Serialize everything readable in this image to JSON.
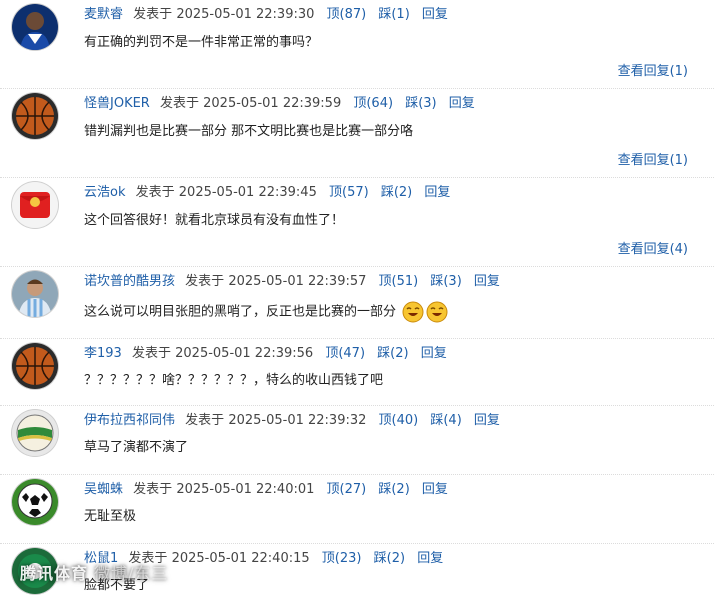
{
  "comments": [
    {
      "user": "麦默睿",
      "posted": "发表于",
      "time": "2025-05-01 22:39:30",
      "up": "顶(87)",
      "down": "踩(1)",
      "reply": "回复",
      "text": "有正确的判罚不是一件非常正常的事吗？",
      "view_replies": "查看回复(1)"
    },
    {
      "user": "怪兽JOKER",
      "posted": "发表于",
      "time": "2025-05-01 22:39:59",
      "up": "顶(64)",
      "down": "踩(3)",
      "reply": "回复",
      "text": "错判漏判也是比赛一部分 那不文明比赛也是比赛一部分咯",
      "view_replies": "查看回复(1)"
    },
    {
      "user": "云浩ok",
      "posted": "发表于",
      "time": "2025-05-01 22:39:45",
      "up": "顶(57)",
      "down": "踩(2)",
      "reply": "回复",
      "text": "这个回答很好！就看北京球员有没有血性了！",
      "view_replies": "查看回复(4)"
    },
    {
      "user": "诺坎普的酷男孩",
      "posted": "发表于",
      "time": "2025-05-01 22:39:57",
      "up": "顶(51)",
      "down": "踩(3)",
      "reply": "回复",
      "text": "这么说可以明目张胆的黑哨了，反正也是比赛的一部分",
      "view_replies": ""
    },
    {
      "user": "李193",
      "posted": "发表于",
      "time": "2025-05-01 22:39:56",
      "up": "顶(47)",
      "down": "踩(2)",
      "reply": "回复",
      "text": "？？？？？？啥？？？？？？，特么的收山西钱了吧",
      "view_replies": ""
    },
    {
      "user": "伊布拉西祁同伟",
      "posted": "发表于",
      "time": "2025-05-01 22:39:32",
      "up": "顶(40)",
      "down": "踩(4)",
      "reply": "回复",
      "text": "草马了演都不演了",
      "view_replies": ""
    },
    {
      "user": "吴蜘蛛",
      "posted": "发表于",
      "time": "2025-05-01 22:40:01",
      "up": "顶(27)",
      "down": "踩(2)",
      "reply": "回复",
      "text": "无耻至极",
      "view_replies": ""
    },
    {
      "user": "松鼠1",
      "posted": "发表于",
      "time": "2025-05-01 22:40:15",
      "up": "顶(23)",
      "down": "踩(2)",
      "reply": "回复",
      "text": "脸都不要了",
      "view_replies": ""
    }
  ],
  "watermark": {
    "text": "腾讯体育",
    "subtext": "微博/东三"
  },
  "avatar_icons": [
    "player-photo",
    "basketball",
    "red-envelope",
    "messi-photo",
    "basketball",
    "volleyball",
    "soccer-ball",
    "billiard-ball"
  ],
  "emoji_icons": [
    "grin-emoji",
    "grin-emoji"
  ],
  "colors": {
    "link": "#1f5fa8",
    "text": "#222222"
  }
}
